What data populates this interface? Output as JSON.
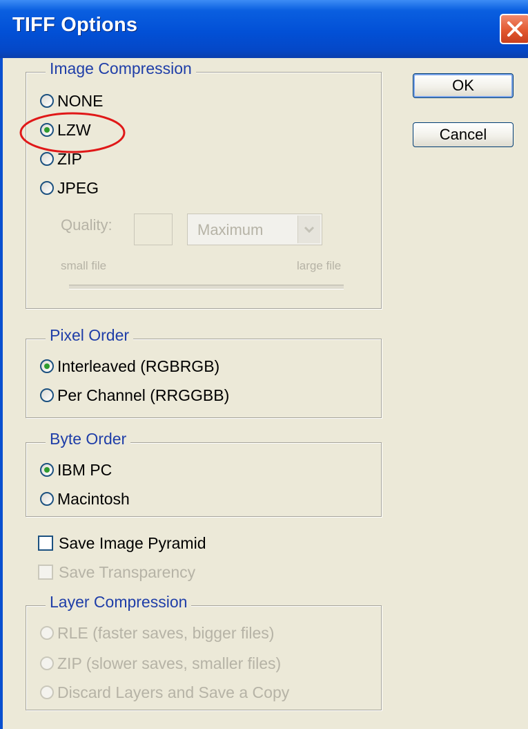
{
  "window": {
    "title": "TIFF Options"
  },
  "buttons": {
    "ok": "OK",
    "cancel": "Cancel"
  },
  "image_compression": {
    "legend": "Image Compression",
    "options": [
      {
        "label": "NONE",
        "selected": false
      },
      {
        "label": "LZW",
        "selected": true
      },
      {
        "label": "ZIP",
        "selected": false
      },
      {
        "label": "JPEG",
        "selected": false
      }
    ],
    "quality_label": "Quality:",
    "quality_value": "",
    "quality_select": "Maximum",
    "small_file": "small file",
    "large_file": "large file"
  },
  "pixel_order": {
    "legend": "Pixel Order",
    "options": [
      {
        "label": "Interleaved (RGBRGB)",
        "selected": true
      },
      {
        "label": "Per Channel (RRGGBB)",
        "selected": false
      }
    ]
  },
  "byte_order": {
    "legend": "Byte Order",
    "options": [
      {
        "label": "IBM PC",
        "selected": true
      },
      {
        "label": "Macintosh",
        "selected": false
      }
    ]
  },
  "checkboxes": {
    "save_image_pyramid": {
      "label": "Save Image Pyramid",
      "checked": false
    },
    "save_transparency": {
      "label": "Save Transparency",
      "checked": false,
      "enabled": false
    }
  },
  "layer_compression": {
    "legend": "Layer Compression",
    "options": [
      {
        "label": "RLE (faster saves, bigger files)",
        "selected": false
      },
      {
        "label": "ZIP (slower saves, smaller files)",
        "selected": false
      },
      {
        "label": "Discard Layers and Save a Copy",
        "selected": false
      }
    ]
  },
  "colors": {
    "titlebar": "#0250d6",
    "highlight_ellipse": "#e01818",
    "radio_selected": "#2e9b2e"
  }
}
